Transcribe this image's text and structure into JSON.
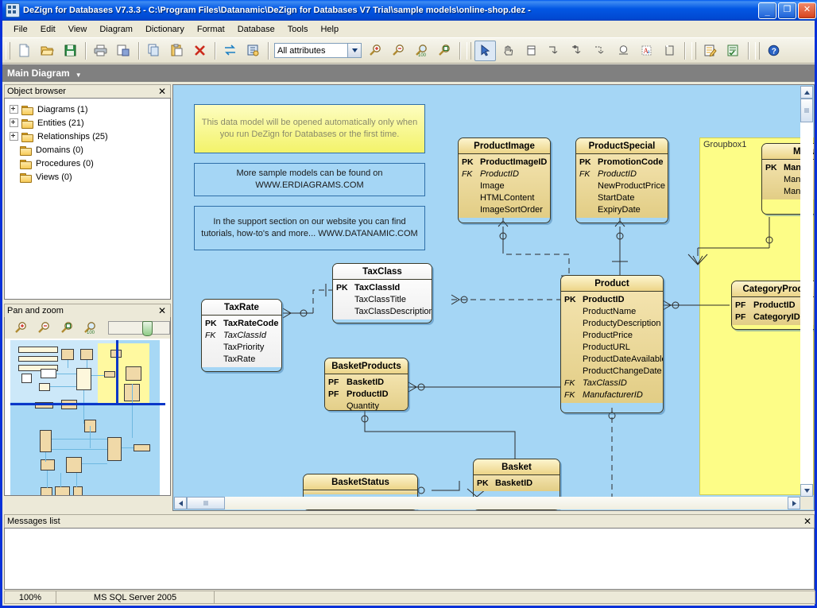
{
  "window": {
    "title": "DeZign for Databases V7.3.3 - C:\\Program Files\\Datanamic\\DeZign for Databases V7 Trial\\sample models\\online-shop.dez -",
    "app_icon": "database-diagram-icon",
    "buttons": {
      "minimize": "_",
      "maximize": "❐",
      "close": "✕"
    }
  },
  "menu": {
    "items": [
      "File",
      "Edit",
      "View",
      "Diagram",
      "Dictionary",
      "Format",
      "Database",
      "Tools",
      "Help"
    ]
  },
  "toolbar": {
    "groups": [
      {
        "buttons": [
          {
            "name": "new-icon",
            "label": "New"
          },
          {
            "name": "open-icon",
            "label": "Open"
          },
          {
            "name": "save-icon",
            "label": "Save"
          }
        ]
      },
      {
        "buttons": [
          {
            "name": "print-icon",
            "label": "Print"
          },
          {
            "name": "print-preview-icon",
            "label": "Print preview"
          }
        ]
      },
      {
        "buttons": [
          {
            "name": "copy-icon",
            "label": "Copy"
          },
          {
            "name": "paste-icon",
            "label": "Paste"
          },
          {
            "name": "delete-icon",
            "label": "Delete"
          }
        ]
      },
      {
        "buttons": [
          {
            "name": "sync-icon",
            "label": "Synchronize"
          },
          {
            "name": "model-check-icon",
            "label": "Model check"
          }
        ]
      }
    ],
    "attribute_filter": {
      "value": "All attributes",
      "placeholder": "All attributes",
      "dropdown_icon": "chevron-down-icon"
    },
    "zoom_buttons": [
      {
        "name": "zoom-in-icon",
        "label": "Zoom in"
      },
      {
        "name": "zoom-out-icon",
        "label": "Zoom out"
      },
      {
        "name": "zoom-100-icon",
        "label": "Zoom 100%"
      },
      {
        "name": "zoom-fit-icon",
        "label": "Zoom to fit"
      }
    ],
    "tools": [
      {
        "name": "pointer-tool-icon",
        "label": "Select",
        "active": true
      },
      {
        "name": "hand-tool-icon",
        "label": "Pan"
      },
      {
        "name": "entity-tool-icon",
        "label": "New entity"
      },
      {
        "name": "relation-1n-tool-icon",
        "label": "One to many relation"
      },
      {
        "name": "relation-optional-tool-icon",
        "label": "Optional relation"
      },
      {
        "name": "relation-identifying-tool-icon",
        "label": "Identifying relation"
      },
      {
        "name": "domain-tool-icon",
        "label": "Domain"
      },
      {
        "name": "text-tool-icon",
        "label": "Text"
      },
      {
        "name": "groupbox-tool-icon",
        "label": "Group box"
      }
    ],
    "right_tools": [
      {
        "name": "edit-entity-icon",
        "label": "Edit entity"
      },
      {
        "name": "checklist-icon",
        "label": "Task list"
      },
      {
        "name": "help-icon",
        "label": "Help"
      }
    ]
  },
  "diagram_tab": {
    "label": "Main Diagram",
    "caret_icon": "caret-down-icon"
  },
  "object_browser": {
    "title": "Object browser",
    "close_icon": "close-icon",
    "items": [
      {
        "label": "Diagrams (1)",
        "expandable": true
      },
      {
        "label": "Entities (21)",
        "expandable": true
      },
      {
        "label": "Relationships (25)",
        "expandable": true
      },
      {
        "label": "Domains (0)",
        "expandable": false
      },
      {
        "label": "Procedures (0)",
        "expandable": false
      },
      {
        "label": "Views (0)",
        "expandable": false
      }
    ]
  },
  "pan_and_zoom": {
    "title": "Pan and zoom",
    "close_icon": "close-icon",
    "buttons": [
      {
        "name": "zoom-in-icon",
        "label": "Zoom in"
      },
      {
        "name": "zoom-out-icon",
        "label": "Zoom out"
      },
      {
        "name": "zoom-fit-icon",
        "label": "Zoom to fit"
      },
      {
        "name": "zoom-100-icon",
        "label": "Zoom 100%"
      }
    ],
    "slider_label": "zoom-slider"
  },
  "diagram": {
    "notes": [
      {
        "id": "note-autoopen",
        "style": "yellow",
        "text": "This data model will be opened automatically only when you run DeZign for Databases or the first time."
      },
      {
        "id": "note-samples",
        "style": "blue",
        "text": "More sample models can be found on WWW.ERDIAGRAMS.COM"
      },
      {
        "id": "note-support",
        "style": "blue",
        "text": "In the support section on our website you can find tutorials, how-to's and more... WWW.DATANAMIC.COM"
      }
    ],
    "groupbox": {
      "label": "Groupbox1"
    },
    "entities": [
      {
        "id": "productimage",
        "name": "ProductImage",
        "style": "gold",
        "attributes": [
          {
            "key": "PK",
            "name": "ProductImageID",
            "kind": "pk"
          },
          {
            "key": "FK",
            "name": "ProductID",
            "kind": "fk"
          },
          {
            "key": "",
            "name": "Image",
            "kind": ""
          },
          {
            "key": "",
            "name": "HTMLContent",
            "kind": ""
          },
          {
            "key": "",
            "name": "ImageSortOrder",
            "kind": ""
          }
        ]
      },
      {
        "id": "productspecial",
        "name": "ProductSpecial",
        "style": "gold",
        "attributes": [
          {
            "key": "PK",
            "name": "PromotionCode",
            "kind": "pk"
          },
          {
            "key": "FK",
            "name": "ProductID",
            "kind": "fk"
          },
          {
            "key": "",
            "name": "NewProductPrice",
            "kind": ""
          },
          {
            "key": "",
            "name": "StartDate",
            "kind": ""
          },
          {
            "key": "",
            "name": "ExpiryDate",
            "kind": ""
          }
        ]
      },
      {
        "id": "manufacturer",
        "name": "Manu",
        "style": "gold",
        "attributes": [
          {
            "key": "PK",
            "name": "Manu",
            "kind": "pk"
          },
          {
            "key": "",
            "name": "Manu",
            "kind": ""
          },
          {
            "key": "",
            "name": "Manu",
            "kind": ""
          }
        ]
      },
      {
        "id": "taxclass",
        "name": "TaxClass",
        "style": "white",
        "attributes": [
          {
            "key": "PK",
            "name": "TaxClassId",
            "kind": "pk"
          },
          {
            "key": "",
            "name": "TaxClassTitle",
            "kind": ""
          },
          {
            "key": "",
            "name": "TaxClassDescription",
            "kind": ""
          }
        ]
      },
      {
        "id": "taxrate",
        "name": "TaxRate",
        "style": "white",
        "attributes": [
          {
            "key": "PK",
            "name": "TaxRateCode",
            "kind": "pk"
          },
          {
            "key": "FK",
            "name": "TaxClassId",
            "kind": "fk"
          },
          {
            "key": "",
            "name": "TaxPriority",
            "kind": ""
          },
          {
            "key": "",
            "name": "TaxRate",
            "kind": ""
          }
        ]
      },
      {
        "id": "product",
        "name": "Product",
        "style": "gold",
        "attributes": [
          {
            "key": "PK",
            "name": "ProductID",
            "kind": "pk"
          },
          {
            "key": "",
            "name": "ProductName",
            "kind": ""
          },
          {
            "key": "",
            "name": "ProductyDescription",
            "kind": ""
          },
          {
            "key": "",
            "name": "ProductPrice",
            "kind": ""
          },
          {
            "key": "",
            "name": "ProductURL",
            "kind": ""
          },
          {
            "key": "",
            "name": "ProductDateAvailable",
            "kind": ""
          },
          {
            "key": "",
            "name": "ProductChangeDate",
            "kind": ""
          },
          {
            "key": "FK",
            "name": "TaxClassID",
            "kind": "fk"
          },
          {
            "key": "FK",
            "name": "ManufacturerID",
            "kind": "fk"
          }
        ]
      },
      {
        "id": "categoryproduct",
        "name": "CategoryProdu",
        "style": "gold",
        "attributes": [
          {
            "key": "PF",
            "name": "ProductID",
            "kind": "pk"
          },
          {
            "key": "PF",
            "name": "CategoryID",
            "kind": "pk"
          }
        ]
      },
      {
        "id": "basketproducts",
        "name": "BasketProducts",
        "style": "gold",
        "attributes": [
          {
            "key": "PF",
            "name": "BasketID",
            "kind": "pk"
          },
          {
            "key": "PF",
            "name": "ProductID",
            "kind": "pk"
          },
          {
            "key": "",
            "name": "Quantity",
            "kind": ""
          }
        ]
      },
      {
        "id": "basketstatus",
        "name": "BasketStatus",
        "style": "gold",
        "attributes": []
      },
      {
        "id": "basket",
        "name": "Basket",
        "style": "gold",
        "attributes": [
          {
            "key": "PK",
            "name": "BasketID",
            "kind": "pk"
          }
        ]
      }
    ]
  },
  "messages": {
    "title": "Messages list",
    "close_icon": "close-icon",
    "content": ""
  },
  "status": {
    "zoom": "100%",
    "database": "MS SQL Server 2005",
    "extra": ""
  },
  "scrollbars": {
    "up_icon": "chevron-up-icon",
    "down_icon": "chevron-down-icon",
    "left_icon": "chevron-left-icon",
    "right_icon": "chevron-right-icon",
    "grip_icon": "grip-icon"
  },
  "colors": {
    "titlebar": "#0057e7",
    "canvas": "#a5d6f5",
    "entity_gold": "#ecd487",
    "entity_white": "#ffffff",
    "groupbox": "#fdfd87",
    "note_yellow": "#f3f36a",
    "chrome": "#ece9d8"
  }
}
